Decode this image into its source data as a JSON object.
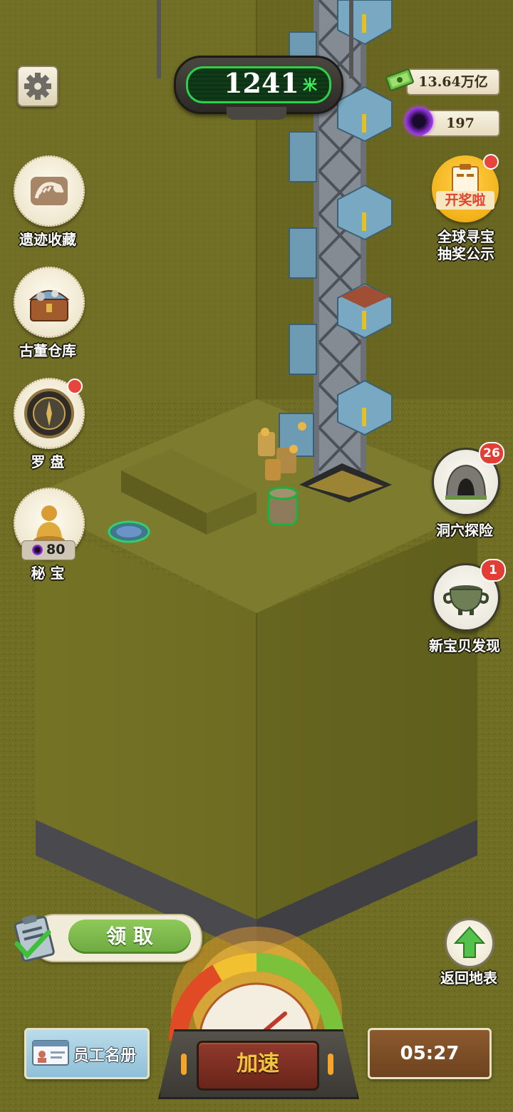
{
  "depth": {
    "value": "1241",
    "unit": "米"
  },
  "resources": {
    "money": "13.64万亿",
    "orbs": "197"
  },
  "left_menu": [
    {
      "label": "遗迹收藏"
    },
    {
      "label": "古董仓库"
    },
    {
      "label": "罗 盘"
    },
    {
      "label": "秘 宝",
      "cost": "80"
    }
  ],
  "right_menu": {
    "lottery": {
      "icon_text": "开奖啦",
      "label_line1": "全球寻宝",
      "label_line2": "抽奖公示"
    },
    "cave": {
      "label": "洞穴探险",
      "badge": "26"
    },
    "discovery": {
      "label": "新宝贝发现",
      "badge": "1"
    }
  },
  "claim_button": "领 取",
  "return_surface": "返回地表",
  "staff_roster": "员工名册",
  "speed_button": "加速",
  "timer": "05:27",
  "colors": {
    "ground": "#6f6e22",
    "depth_green": "#2bd14a",
    "claim_green": "#7cb84b"
  }
}
